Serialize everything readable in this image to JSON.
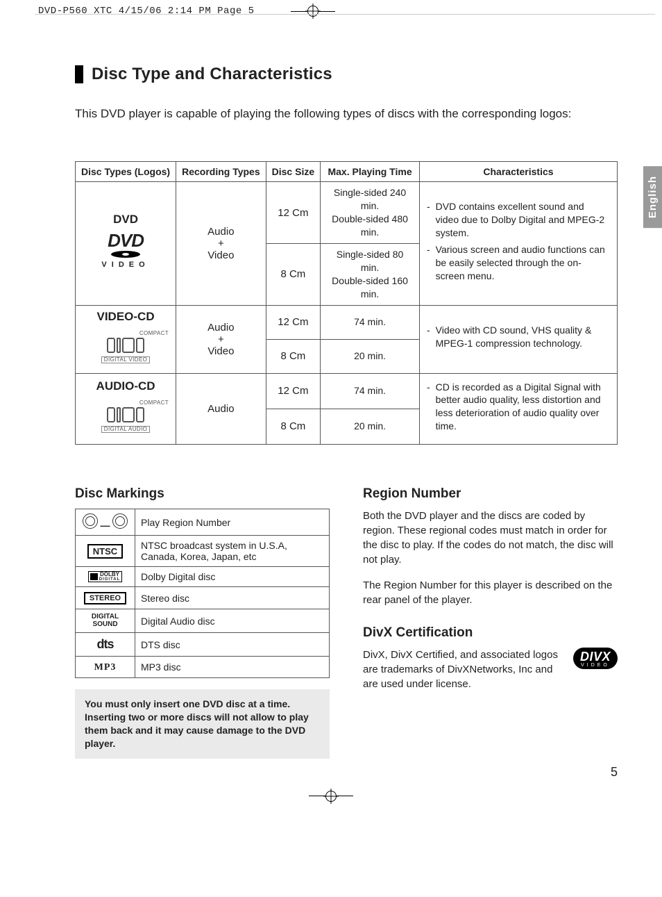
{
  "print_header": "DVD-P560_XTC  4/15/06  2:14 PM  Page 5",
  "language_tab": "English",
  "page_number": "5",
  "section_title": "Disc Type and Characteristics",
  "intro": "This DVD player is capable of playing the following types of discs with the corresponding logos:",
  "disc_table": {
    "headers": {
      "types": "Disc Types (Logos)",
      "rec": "Recording Types",
      "size": "Disc Size",
      "time": "Max. Playing Time",
      "char": "Characteristics"
    },
    "rows": [
      {
        "label": "DVD",
        "logo_text": {
          "top": "DVD",
          "bottom": "VIDEO"
        },
        "recording": "Audio\n+\nVideo",
        "sizes": [
          {
            "size": "12 Cm",
            "time": "Single-sided 240 min.\nDouble-sided 480 min."
          },
          {
            "size": "8 Cm",
            "time": "Single-sided 80 min.\nDouble-sided 160 min."
          }
        ],
        "characteristics": [
          "DVD contains excellent sound and video due to Dolby Digital and MPEG-2 system.",
          "Various screen and audio functions can be easily selected through the on-screen menu."
        ]
      },
      {
        "label": "VIDEO-CD",
        "logo_text": {
          "compact": "COMPACT",
          "sub": "DIGITAL VIDEO"
        },
        "recording": "Audio\n+\nVideo",
        "sizes": [
          {
            "size": "12 Cm",
            "time": "74 min."
          },
          {
            "size": "8 Cm",
            "time": "20 min."
          }
        ],
        "characteristics": [
          "Video with CD sound, VHS quality & MPEG-1 compression technology."
        ]
      },
      {
        "label": "AUDIO-CD",
        "logo_text": {
          "compact": "COMPACT",
          "sub": "DIGITAL AUDIO"
        },
        "recording": "Audio",
        "sizes": [
          {
            "size": "12 Cm",
            "time": "74 min."
          },
          {
            "size": "8 Cm",
            "time": "20 min."
          }
        ],
        "characteristics": [
          "CD is recorded as a Digital Signal with better audio quality, less distortion and less deterioration of audio quality over time."
        ]
      }
    ]
  },
  "disc_markings": {
    "title": "Disc Markings",
    "rows": [
      {
        "mark_kind": "globes",
        "desc": "Play Region Number"
      },
      {
        "mark_kind": "ntsc",
        "mark_text": "NTSC",
        "desc": "NTSC broadcast system in U.S.A, Canada, Korea, Japan, etc"
      },
      {
        "mark_kind": "dolby",
        "mark_text": "DOLBY",
        "mark_sub": "DIGITAL",
        "desc": "Dolby Digital disc"
      },
      {
        "mark_kind": "stereo",
        "mark_text": "STEREO",
        "desc": "Stereo disc"
      },
      {
        "mark_kind": "digital_sound",
        "mark_text_1": "DIGITAL",
        "mark_text_2": "SOUND",
        "desc": "Digital Audio disc"
      },
      {
        "mark_kind": "dts",
        "mark_text": "dts",
        "desc": "DTS disc"
      },
      {
        "mark_kind": "mp3",
        "mark_text": "MP3",
        "desc": "MP3 disc"
      }
    ],
    "warning": "You must only insert one DVD disc at a time. Inserting two or more discs will not allow to play them back and it may cause damage to the DVD player."
  },
  "region_number": {
    "title": "Region Number",
    "p1": "Both the DVD player and the discs are coded by region. These regional codes must match in order for the disc to play. If the codes do not match, the disc will not play.",
    "p2": "The Region Number for this player is described on the rear panel of the player."
  },
  "divx": {
    "title": "DivX Certification",
    "text": "DivX, DivX Certified, and associated logos are trademarks of DivXNetworks, Inc and are used under license.",
    "logo_main": "DIVX",
    "logo_sub": "VIDEO"
  }
}
